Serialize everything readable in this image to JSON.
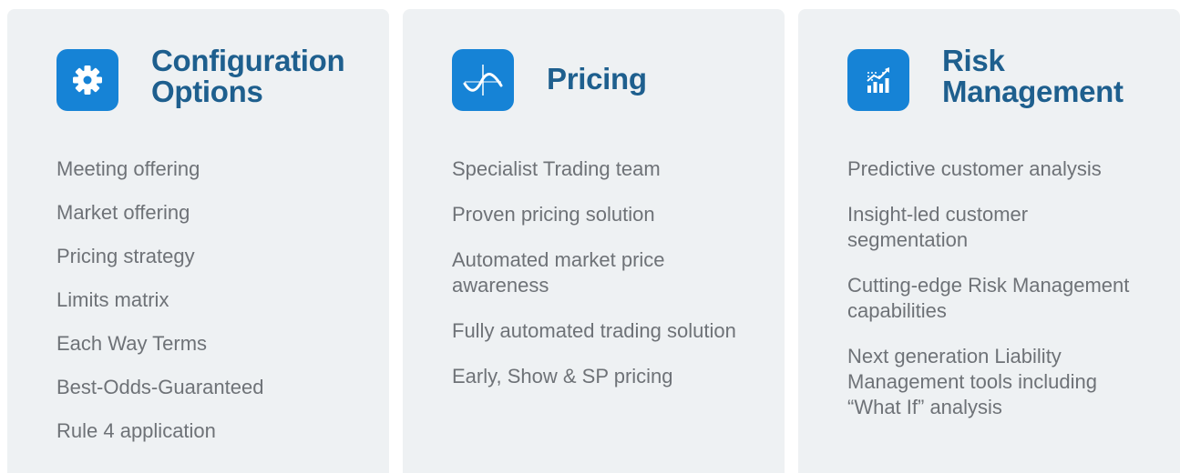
{
  "cards": [
    {
      "icon": "gear-icon",
      "title": "Configuration Options",
      "items": [
        "Meeting offering",
        "Market offering",
        "Pricing strategy",
        "Limits matrix",
        "Each Way Terms",
        "Best-Odds-Guaranteed",
        "Rule 4 application"
      ]
    },
    {
      "icon": "sine-wave-icon",
      "title": "Pricing",
      "items": [
        "Specialist Trading team",
        "Proven pricing solution",
        "Automated market price awareness",
        "Fully automated trading solution",
        "Early, Show & SP pricing"
      ]
    },
    {
      "icon": "bar-chart-trend-icon",
      "title": "Risk Management",
      "items": [
        "Predictive customer analysis",
        "Insight-led customer segmentation",
        "Cutting-edge Risk Management capabilities",
        "Next generation Liability Management tools including “What If” analysis"
      ]
    }
  ],
  "colors": {
    "card_background": "#eef1f3",
    "icon_background": "#1683d6",
    "title": "#1e5f8e",
    "item_text": "#6e7277"
  }
}
